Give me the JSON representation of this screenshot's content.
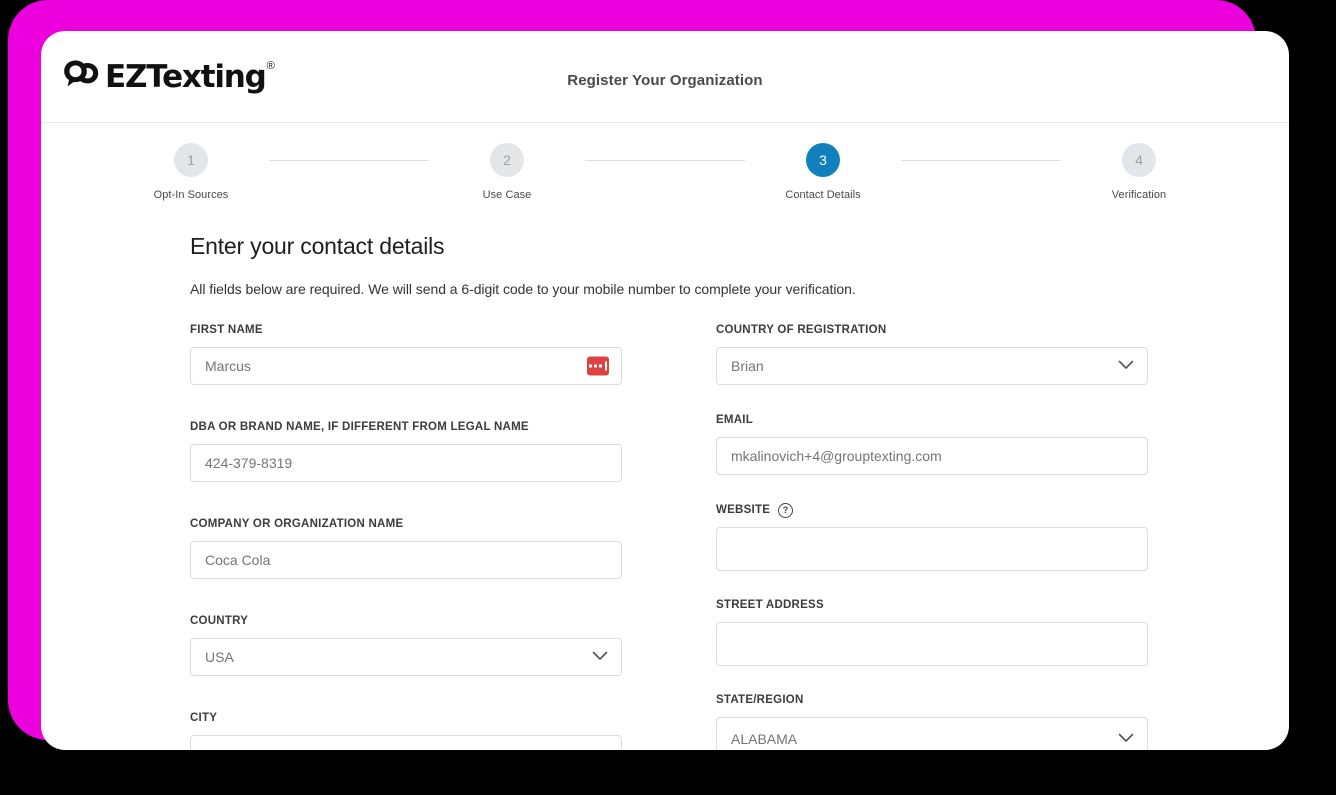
{
  "brand": {
    "logo_text": "EZTexting",
    "logo_registered": "®",
    "magenta": "#ED00DE",
    "accent_blue": "#1180BD"
  },
  "header": {
    "title": "Register Your Organization"
  },
  "stepper": {
    "active_step": 3,
    "steps": [
      {
        "number": "1",
        "label": "Opt-In Sources"
      },
      {
        "number": "2",
        "label": "Use Case"
      },
      {
        "number": "3",
        "label": "Contact Details"
      },
      {
        "number": "4",
        "label": "Verification"
      }
    ]
  },
  "main": {
    "heading": "Enter your contact details",
    "subheading": "All fields below are required. We will send a 6-digit code to your mobile number to complete your verification.",
    "left_fields": [
      {
        "label": "FIRST NAME",
        "value": "",
        "placeholder": "Marcus",
        "type": "text",
        "badge": "autofill-badge"
      },
      {
        "label": "DBA OR BRAND NAME, IF DIFFERENT FROM LEGAL NAME",
        "value": "",
        "placeholder": "424-379-8319",
        "type": "text"
      },
      {
        "label": "COMPANY OR ORGANIZATION NAME",
        "value": "",
        "placeholder": "Coca Cola",
        "type": "text"
      },
      {
        "label": "COUNTRY",
        "value": "",
        "placeholder": "USA",
        "type": "select"
      },
      {
        "label": "CITY",
        "value": "",
        "placeholder": "",
        "type": "text"
      }
    ],
    "right_fields": [
      {
        "label": "COUNTRY OF REGISTRATION",
        "value": "",
        "placeholder": "Brian",
        "type": "select"
      },
      {
        "label": "EMAIL",
        "value": "",
        "placeholder": "mkalinovich+4@grouptexting.com",
        "type": "text"
      },
      {
        "label": "WEBSITE",
        "value": "",
        "placeholder": "",
        "type": "text",
        "help": "?",
        "tall": true
      },
      {
        "label": "STREET ADDRESS",
        "value": "",
        "placeholder": "",
        "type": "text",
        "tall": true
      },
      {
        "label": "STATE/REGION",
        "value": "",
        "placeholder": "ALABAMA",
        "type": "select",
        "tall": true
      }
    ]
  }
}
